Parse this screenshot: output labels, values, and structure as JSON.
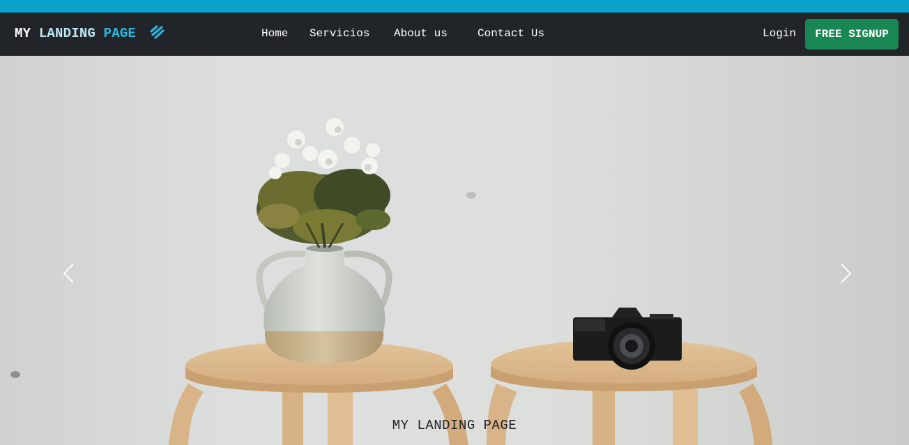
{
  "brand": {
    "word1": "MY",
    "word2": "LANDING",
    "word3": "PAGE",
    "icon": "squarespace-icon"
  },
  "nav": {
    "items": [
      {
        "label": "Home"
      },
      {
        "label": "Servicios"
      },
      {
        "label": "About us"
      },
      {
        "label": "Contact Us"
      }
    ],
    "login_label": "Login",
    "signup_label": "FREE SIGNUP"
  },
  "carousel": {
    "caption": "MY LANDING PAGE",
    "prev_icon": "chevron-left-icon",
    "next_icon": "chevron-right-icon"
  },
  "colors": {
    "top_strip": "#0aa3cc",
    "navbar_bg": "#212529",
    "signup_bg": "#198754",
    "brand_accent": "#2bb7df"
  }
}
